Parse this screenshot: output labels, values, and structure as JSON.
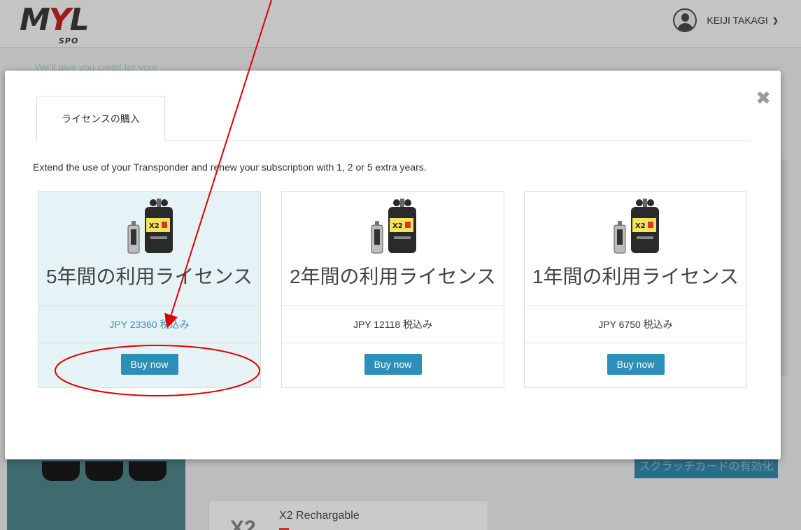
{
  "header": {
    "logo_main": "MYL",
    "logo_sub": "SPO",
    "user_name": "KEIJI TAKAGI",
    "user_menu_icon": "chevron-down-icon"
  },
  "background": {
    "left_card_text": "We'll give you credit for your",
    "right_button_label": "スクラッチカードの有効化",
    "product_name": "X2 Rechargable",
    "product_icon_text": "X2"
  },
  "modal": {
    "close_icon": "close-icon",
    "tab_label": "ライセンスの購入",
    "description": "Extend the use of your Transponder and renew your subscription with 1, 2 or 5 extra years.",
    "cards": [
      {
        "title": "5年間の利用ライセンス",
        "price": "JPY 23360 税込み",
        "button": "Buy now",
        "selected": true
      },
      {
        "title": "2年間の利用ライセンス",
        "price": "JPY 12118 税込み",
        "button": "Buy now",
        "selected": false
      },
      {
        "title": "1年間の利用ライセンス",
        "price": "JPY 6750 税込み",
        "button": "Buy now",
        "selected": false
      }
    ]
  },
  "colors": {
    "accent": "#2d8fb9",
    "selected_card_bg": "#e6f3f6",
    "annotation_red": "#e00000"
  }
}
